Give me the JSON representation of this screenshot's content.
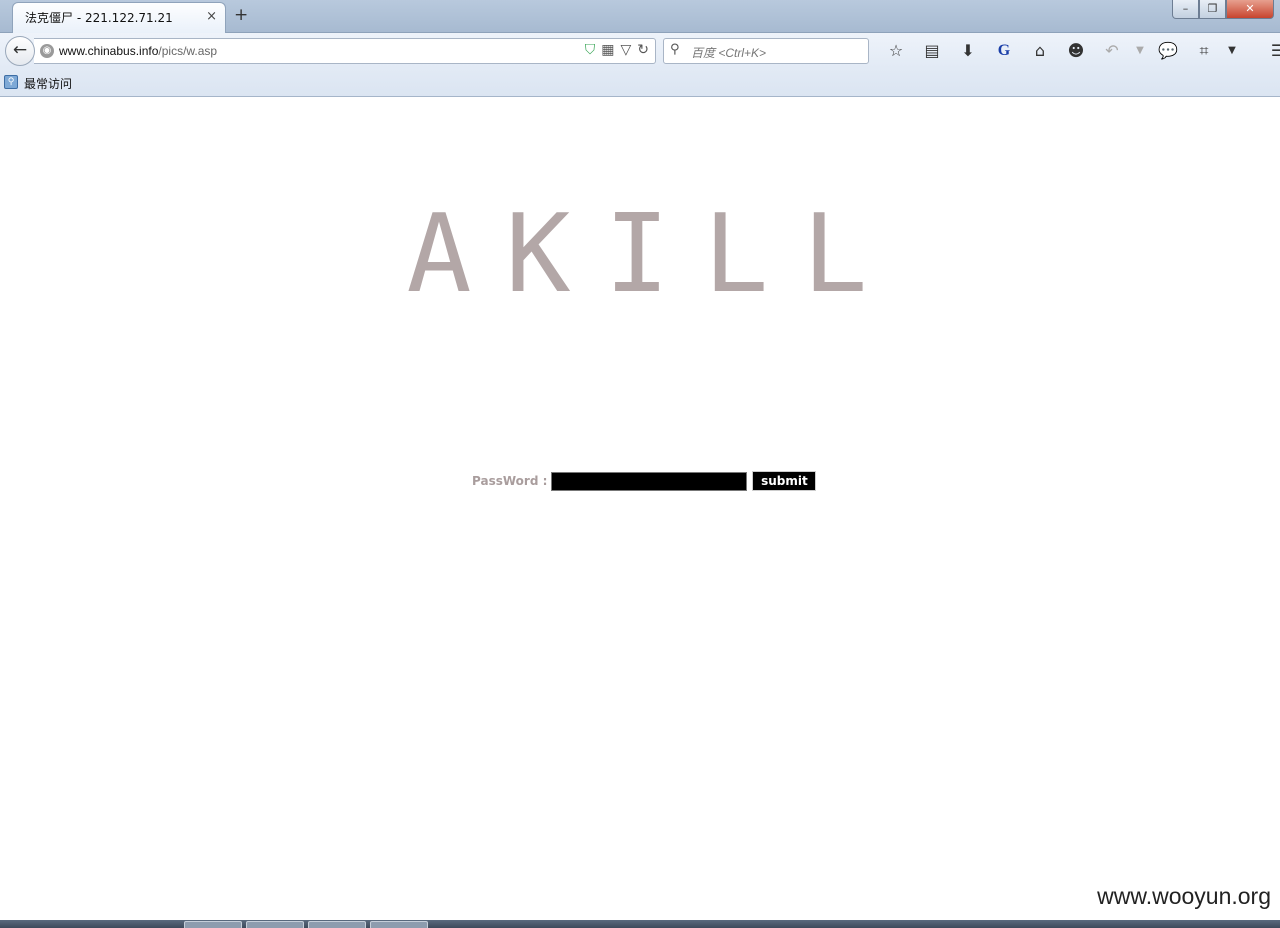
{
  "browser": {
    "tab": {
      "title": "法克僵尸 - 221.122.71.21",
      "close": "×"
    },
    "new_tab": "+",
    "window_buttons": {
      "minimize": "–",
      "restore": "❐",
      "close": "✕"
    },
    "nav": {
      "back": "←",
      "url_host": "www.chinabus.info",
      "url_path": "/pics/w.asp",
      "search_placeholder": "百度 <Ctrl+K>"
    },
    "bookmarks": {
      "most_visited": "最常访问"
    }
  },
  "page": {
    "heading": "AKILL",
    "password_label": "PassWord :",
    "password_value": "",
    "submit_label": "submit",
    "heading_color": "#b3a7a7",
    "label_color": "#a99d9d"
  },
  "watermark": "www.wooyun.org"
}
